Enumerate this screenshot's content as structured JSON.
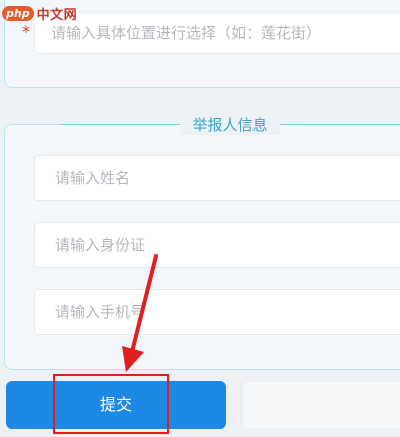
{
  "watermark": {
    "badge": "php",
    "site": "中文网"
  },
  "location": {
    "required_mark": "*",
    "placeholder": "请输入具体位置进行选择（如：莲花街）"
  },
  "reporter": {
    "title": "举报人信息",
    "name_placeholder": "请输入姓名",
    "id_placeholder": "请输入身份证",
    "phone_placeholder": "请输入手机号"
  },
  "actions": {
    "submit_label": "提交"
  },
  "colors": {
    "accent": "#1e88e5",
    "border": "#b9e6ee",
    "title": "#3aa6c9",
    "annotation": "#e02020"
  }
}
